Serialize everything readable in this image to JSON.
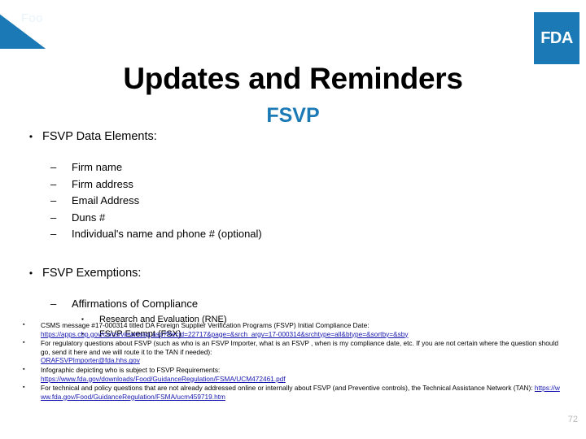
{
  "slide": {
    "corner_banner_label": "Foo",
    "logo_text": "FDA",
    "title": "Updates and Reminders",
    "subtitle": "FSVP",
    "page_number": "72",
    "colors": {
      "brand_blue": "#1b7ab5",
      "link_blue": "#1515b0",
      "page_number_gray": "#b8b8b8"
    }
  },
  "markers": {
    "level1": "•",
    "level2": "–",
    "level3": "▪",
    "footer": "▪"
  },
  "sections": [
    {
      "heading": "FSVP Data Elements:",
      "items": [
        "Firm name",
        "Firm address",
        "Email Address",
        "Duns #",
        "Individual's name and phone # (optional)"
      ]
    },
    {
      "heading": "FSVP Exemptions:",
      "items": [
        "Affirmations of Compliance"
      ],
      "subitems": [
        "Research and Evaluation (RNE)",
        "FSVP Exempt (FSX)"
      ]
    }
  ],
  "footer_notes": [
    {
      "text": "CSMS message #17-000314 titled DA Foreign Supplier Verification Programs (FSVP) Initial Compliance Date:",
      "link": "https://apps.cbp.gov/csms/viewmssg.asp?Recid=22717&page=&srch_argv=17-000314&srchtype=all&btype=&sortby=&sby"
    },
    {
      "text": "For regulatory questions about FSVP (such as who is an FSVP Importer, what is an FSVP , when is my compliance date, etc. If you are not certain where the question should go, send it here and we will route it to the TAN if needed):",
      "link": "ORAFSVPImporter@fda.hhs.gov"
    },
    {
      "text": "Infographic depicting who is subject to FSVP Requirements:",
      "link": "https://www.fda.gov/downloads/Food/GuidanceRegulation/FSMA/UCM472461.pdf"
    },
    {
      "text": "For technical and policy questions that are not already addressed online or internally about FSVP (and Preventive controls), the Technical Assistance Network (TAN): ",
      "link": "https://www.fda.gov/Food/GuidanceRegulation/FSMA/ucm459719.htm",
      "inline": true
    }
  ]
}
